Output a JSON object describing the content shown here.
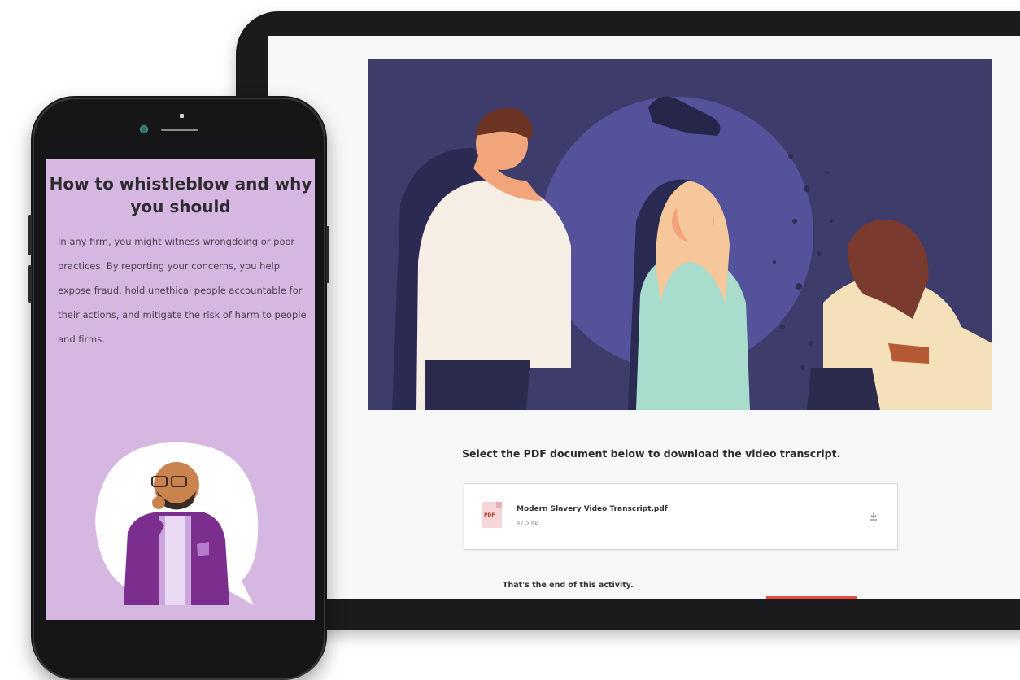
{
  "tablet": {
    "transcript_note": "Select the PDF document below to download the video transcript.",
    "file": {
      "badge": "PDF",
      "name": "Modern Slavery Video Transcript.pdf",
      "size": "47.5 KB"
    },
    "end_text": "That's the end of this activity."
  },
  "phone": {
    "title": "How to whistleblow and why you should",
    "body": "In any firm, you might witness wrongdoing or poor practices. By reporting your concerns, you help expose fraud, hold unethical people accountable for their actions, and mitigate the risk of harm to people and firms."
  },
  "icons": [
    "pdf-file-icon",
    "download-icon"
  ],
  "colors": {
    "hero_background": "#3d3c6b",
    "phone_screen": "#d6b7e2",
    "accent_red": "#e74c3c"
  }
}
